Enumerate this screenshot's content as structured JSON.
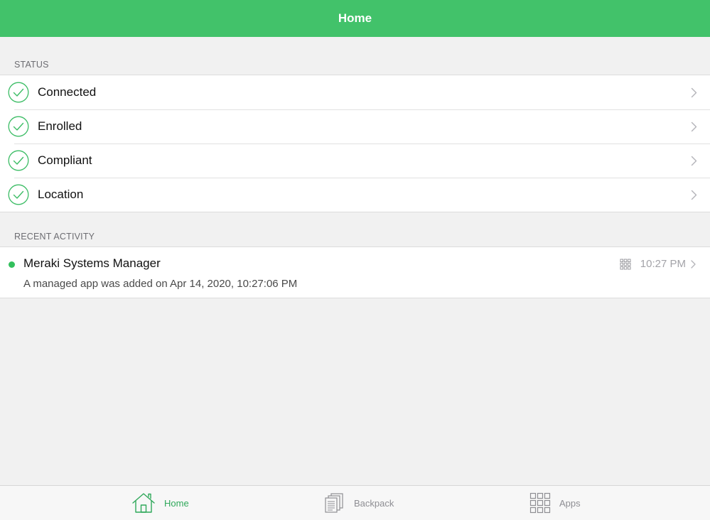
{
  "navbar": {
    "title": "Home",
    "color": "#42c26a"
  },
  "status": {
    "header": "STATUS",
    "items": [
      {
        "label": "Connected",
        "icon": "check-circle-icon"
      },
      {
        "label": "Enrolled",
        "icon": "check-circle-icon"
      },
      {
        "label": "Compliant",
        "icon": "check-circle-icon"
      },
      {
        "label": "Location",
        "icon": "check-circle-icon"
      }
    ]
  },
  "recent_activity": {
    "header": "RECENT ACTIVITY",
    "items": [
      {
        "title": "Meraki Systems Manager",
        "detail": "A managed app was added on Apr 14, 2020, 10:27:06 PM",
        "time": "10:27 PM",
        "icon": "apps-grid-icon"
      }
    ]
  },
  "tabbar": {
    "tabs": [
      {
        "label": "Home",
        "icon": "home-icon",
        "active": true
      },
      {
        "label": "Backpack",
        "icon": "backpack-documents-icon",
        "active": false
      },
      {
        "label": "Apps",
        "icon": "apps-grid-icon",
        "active": false
      }
    ],
    "active_color": "#2fa85a",
    "inactive_color": "#8e8e93"
  }
}
